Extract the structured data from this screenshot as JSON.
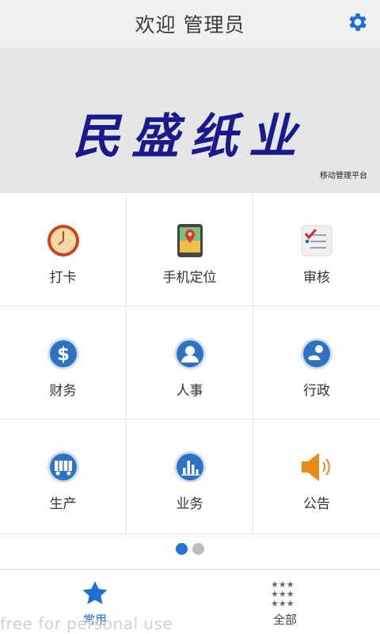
{
  "header": {
    "title": "欢迎 管理员",
    "settings_icon": "gear-icon"
  },
  "banner": {
    "logo_text": "民盛纸业",
    "slogan": "移动管理平台"
  },
  "grid": {
    "items": [
      {
        "label": "打卡",
        "icon": "clock-icon"
      },
      {
        "label": "手机定位",
        "icon": "map-location-icon"
      },
      {
        "label": "审核",
        "icon": "checklist-icon"
      },
      {
        "label": "财务",
        "icon": "dollar-icon"
      },
      {
        "label": "人事",
        "icon": "user-icon"
      },
      {
        "label": "行政",
        "icon": "admin-icon"
      },
      {
        "label": "生产",
        "icon": "truck-icon"
      },
      {
        "label": "业务",
        "icon": "bar-chart-icon"
      },
      {
        "label": "公告",
        "icon": "speaker-icon"
      }
    ]
  },
  "pager": {
    "active_page": 1,
    "total_pages": 2
  },
  "tabbar": {
    "items": [
      {
        "label": "常用",
        "icon": "star-icon",
        "active": true
      },
      {
        "label": "全部",
        "icon": "grid-stars-icon",
        "active": false
      }
    ]
  },
  "watermark": "free for personal use",
  "colors": {
    "accent": "#1f6fd1",
    "logo": "#1a1a8c",
    "speaker": "#e88a16"
  }
}
